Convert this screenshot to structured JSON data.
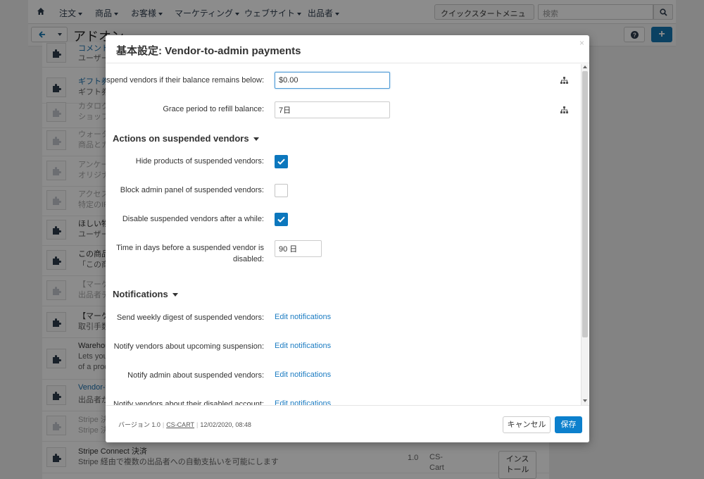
{
  "background": {
    "nav": [
      "注文",
      "商品",
      "お客様",
      "マーケティング",
      "ウェブサイト",
      "出品者"
    ],
    "quickstart_label": "クイックスタートメニュー",
    "search_placeholder": "検索",
    "page_title": "アドオン",
    "rows": [
      {
        "title": "コメント",
        "desc": "ユーザー"
      },
      {
        "title": "ギフト券",
        "desc": "ギフト券"
      },
      {
        "title": "カタログ",
        "desc": "ショップ"
      },
      {
        "title": "ウォータ",
        "desc": "商品とカ"
      },
      {
        "title": "アンケー",
        "desc": "オリジナ"
      },
      {
        "title": "アクセス",
        "desc": "特定のIP"
      },
      {
        "title": "ほしい物",
        "desc": "ユーザー"
      },
      {
        "title": "この商品",
        "desc": "「この商"
      },
      {
        "title": "【マーケ",
        "desc": "出品者デ"
      },
      {
        "title": "【マーケ",
        "desc": "取引手数"
      },
      {
        "title": "Warehou",
        "desc": "Lets you",
        "desc2": "of a prod"
      },
      {
        "title": "Vendor-to",
        "desc": "出品者が"
      },
      {
        "title": "Stripe 決",
        "desc": "Stripe 決"
      },
      {
        "title": "Stripe Connect 決済",
        "desc": "Stripe 経由で複数の出品者への自動支払いを可能にします"
      }
    ],
    "last_row_version": "1.0",
    "last_row_source_a": "CS-",
    "last_row_source_b": "Cart",
    "install_a": "インス",
    "install_b": "トール"
  },
  "modal": {
    "title": "基本設定: Vendor-to-admin payments",
    "close": "×",
    "fields": {
      "suspend_label": "Suspend vendors if their balance remains below:",
      "suspend_value": "$0.00",
      "grace_label": "Grace period to refill balance:",
      "grace_value": "7日"
    },
    "section_actions": "Actions on suspended vendors",
    "actions": {
      "hide_label": "Hide products of suspended vendors:",
      "hide_checked": true,
      "block_label": "Block admin panel of suspended vendors:",
      "block_checked": false,
      "disable_label": "Disable suspended vendors after a while:",
      "disable_checked": true,
      "days_label_1": "Time in days before a suspended vendor is",
      "days_label_2": "disabled:",
      "days_value": "90 日"
    },
    "section_notifications": "Notifications",
    "notifications": [
      {
        "label": "Send weekly digest of suspended vendors:",
        "link": "Edit notifications"
      },
      {
        "label": "Notify vendors about upcoming suspension:",
        "link": "Edit notifications"
      },
      {
        "label": "Notify admin about suspended vendors:",
        "link": "Edit notifications"
      },
      {
        "label": "Notify vendors about their disabled account:",
        "link": "Edit notifications"
      }
    ],
    "footer": {
      "version": "バージョン 1.0",
      "vendor": "CS-CART",
      "date": "12/02/2020, 08:48",
      "cancel": "キャンセル",
      "save": "保存"
    }
  },
  "colors": {
    "primary": "#0c80cd",
    "link": "#1c7cc2",
    "checkbox_on": "#0c77bd"
  },
  "icons": [
    "home-icon",
    "search-icon",
    "back-arrow-icon",
    "help-icon",
    "plus-icon",
    "puzzle-icon",
    "close-icon",
    "tree-icon",
    "check-icon"
  ]
}
